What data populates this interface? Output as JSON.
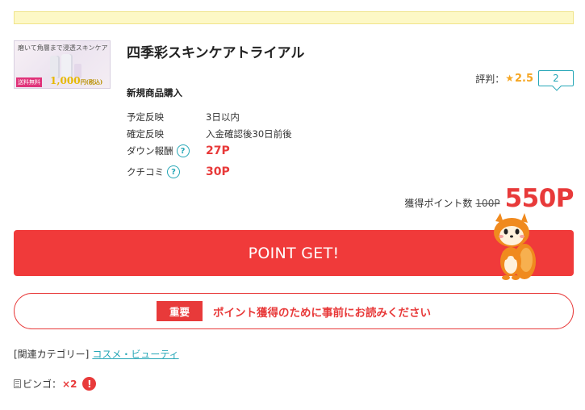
{
  "notice_bar": {
    "text": ""
  },
  "product": {
    "thumbnail": {
      "headline": "磨いて角層まで浸透スキンケア",
      "badge": "送料無料",
      "price": "1,000",
      "price_suffix": "円(税込)"
    },
    "title": "四季彩スキンケアトライアル",
    "rating": {
      "label": "評判：",
      "star": "★",
      "value": "2.5",
      "review_count": "2"
    },
    "subhead": "新規商品購入",
    "details": [
      {
        "label": "予定反映",
        "value": "3日以内"
      },
      {
        "label": "確定反映",
        "value": "入金確認後30日前後"
      },
      {
        "label": "ダウン報酬",
        "help": "?",
        "value": "27P"
      },
      {
        "label": "クチコミ",
        "help": "?",
        "value": "30P"
      }
    ],
    "total": {
      "label": "獲得ポイント数",
      "old": "100P",
      "new": "550P"
    }
  },
  "actions": {
    "point_get_label": "POINT GET!",
    "important_badge": "重要",
    "important_text": "ポイント獲得のために事前にお読みください"
  },
  "category": {
    "label": "[関連カテゴリー]",
    "link": "コスメ・ビューティ"
  },
  "bingo": {
    "label": "ビンゴ：",
    "count": "×2",
    "alert": "!"
  },
  "colors": {
    "accent_red": "#f03a3a",
    "teal": "#26a7b7",
    "star": "#f5a623",
    "notice": "#fdf8c6"
  }
}
